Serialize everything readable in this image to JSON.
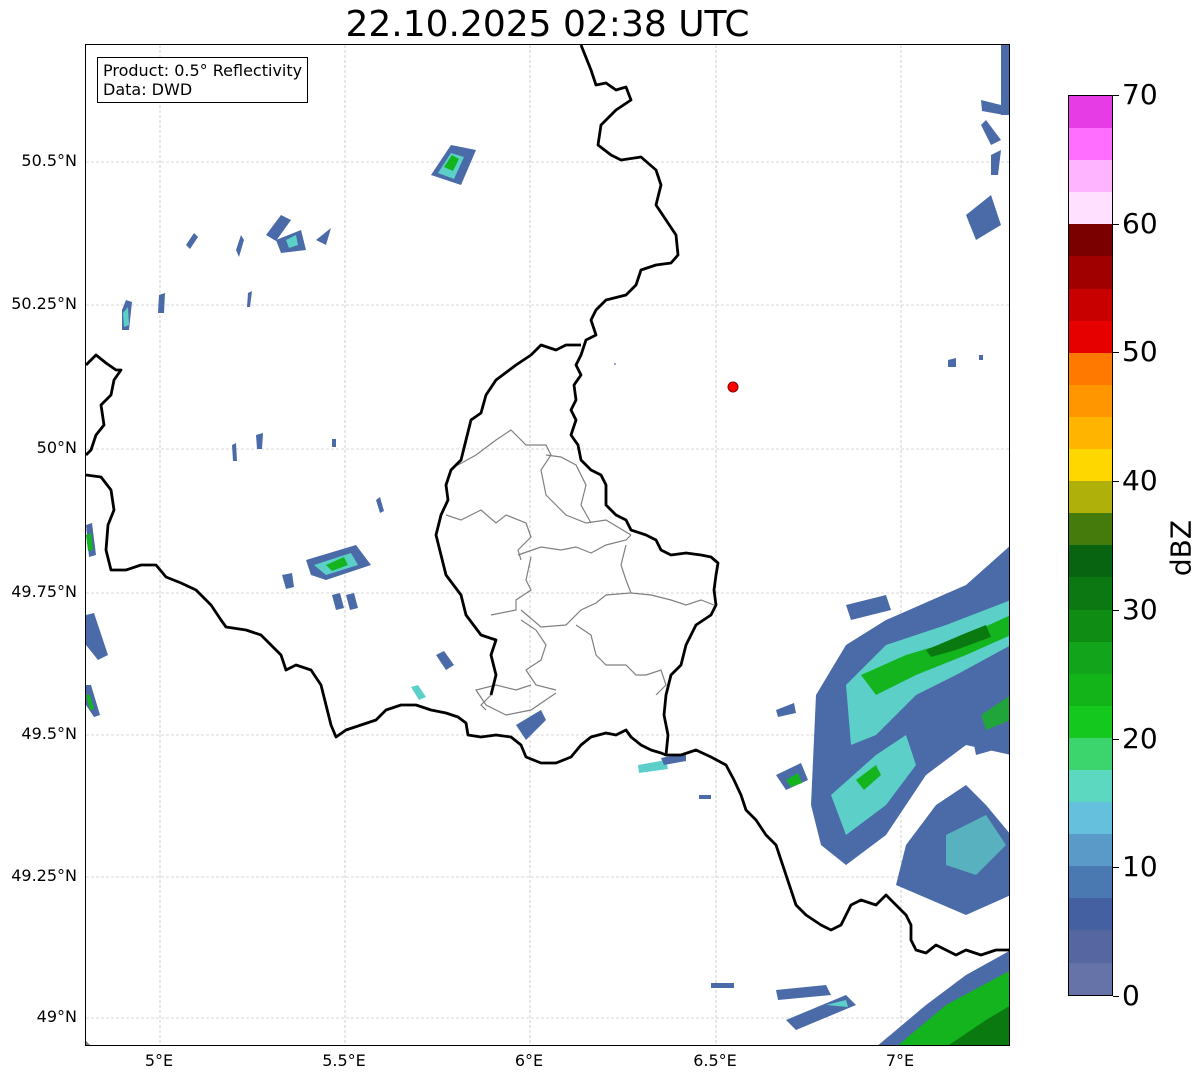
{
  "title": "22.10.2025 02:38 UTC",
  "info": {
    "product": "Product: 0.5° Reflectivity",
    "data": "Data: DWD"
  },
  "axes": {
    "lat_labels": [
      "50.5°N",
      "50.25°N",
      "50°N",
      "49.75°N",
      "49.5°N",
      "49.25°N",
      "49°N"
    ],
    "lon_labels": [
      "5°E",
      "5.5°E",
      "6°E",
      "6.5°E",
      "7°E"
    ],
    "lon_range": [
      4.8,
      7.3
    ],
    "lat_range": [
      48.95,
      50.7
    ],
    "grid": true
  },
  "marker": {
    "label": "radar-site",
    "lon": 6.55,
    "lat": 50.11,
    "color": "#ff0000"
  },
  "colorbar": {
    "unit": "dBZ",
    "ticks": [
      "0",
      "10",
      "20",
      "30",
      "40",
      "50",
      "60",
      "70"
    ],
    "range": [
      0,
      70
    ],
    "colors": [
      "#6673a8",
      "#5566a0",
      "#4560a0",
      "#4a78b0",
      "#5a9ac8",
      "#64c0dc",
      "#5cd8c0",
      "#3cd46c",
      "#14c81e",
      "#12b41a",
      "#12a41a",
      "#0e8c14",
      "#0c7812",
      "#086410",
      "#457a0c",
      "#b0b00a",
      "#ffd700",
      "#ffb400",
      "#ff9600",
      "#ff7800",
      "#e60000",
      "#c80000",
      "#a00000",
      "#7a0000",
      "#ffe0ff",
      "#ffb4ff",
      "#ff6eff",
      "#e63ce6"
    ]
  },
  "colors": {
    "border_national": "#000000",
    "border_regional": "#808080",
    "echo_low": "#4a6aa8",
    "echo_mid": "#5cd0c8",
    "echo_high": "#14b41e",
    "echo_strong": "#0a7a10"
  }
}
